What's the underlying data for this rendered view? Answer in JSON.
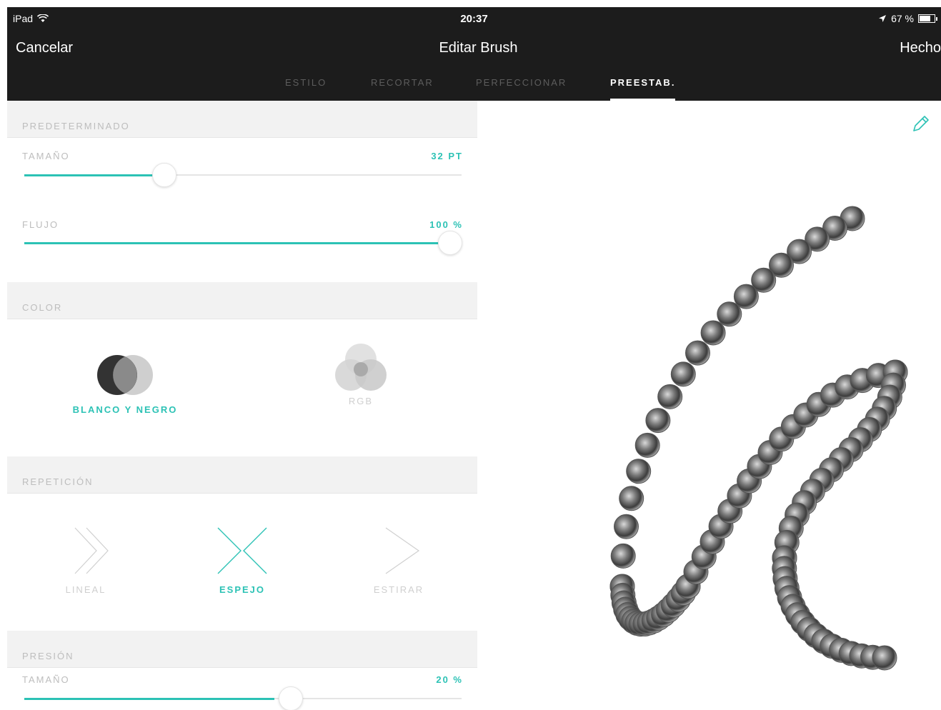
{
  "status": {
    "device": "iPad",
    "time": "20:37",
    "battery": "67 %"
  },
  "nav": {
    "cancel": "Cancelar",
    "title": "Editar Brush",
    "done": "Hecho"
  },
  "tabs": [
    {
      "label": "ESTILO",
      "active": false
    },
    {
      "label": "RECORTAR",
      "active": false
    },
    {
      "label": "PERFECCIONAR",
      "active": false
    },
    {
      "label": "PREESTAB.",
      "active": true
    }
  ],
  "preset": {
    "header": "PREDETERMINADO",
    "size": {
      "label": "TAMAÑO",
      "value": "32 PT",
      "fraction": 0.32
    },
    "flow": {
      "label": "FLUJO",
      "value": "100 %",
      "fraction": 1.0
    }
  },
  "color": {
    "header": "COLOR",
    "options": [
      {
        "label": "BLANCO Y NEGRO",
        "active": true
      },
      {
        "label": "RGB",
        "active": false
      }
    ]
  },
  "repeat": {
    "header": "REPETICIÓN",
    "options": [
      {
        "label": "LINEAL",
        "active": false
      },
      {
        "label": "ESPEJO",
        "active": true
      },
      {
        "label": "ESTIRAR",
        "active": false
      }
    ]
  },
  "pressure": {
    "header": "PRESIÓN",
    "size": {
      "label": "TAMAÑO",
      "value": "20 %",
      "fraction": 0.6
    }
  },
  "colors": {
    "accent": "#2cc2b5",
    "topbar": "#1c1c1c"
  },
  "icons": {
    "wifi": "wifi-icon",
    "location": "location-icon",
    "battery": "battery-icon",
    "edit": "pencil-icon"
  }
}
